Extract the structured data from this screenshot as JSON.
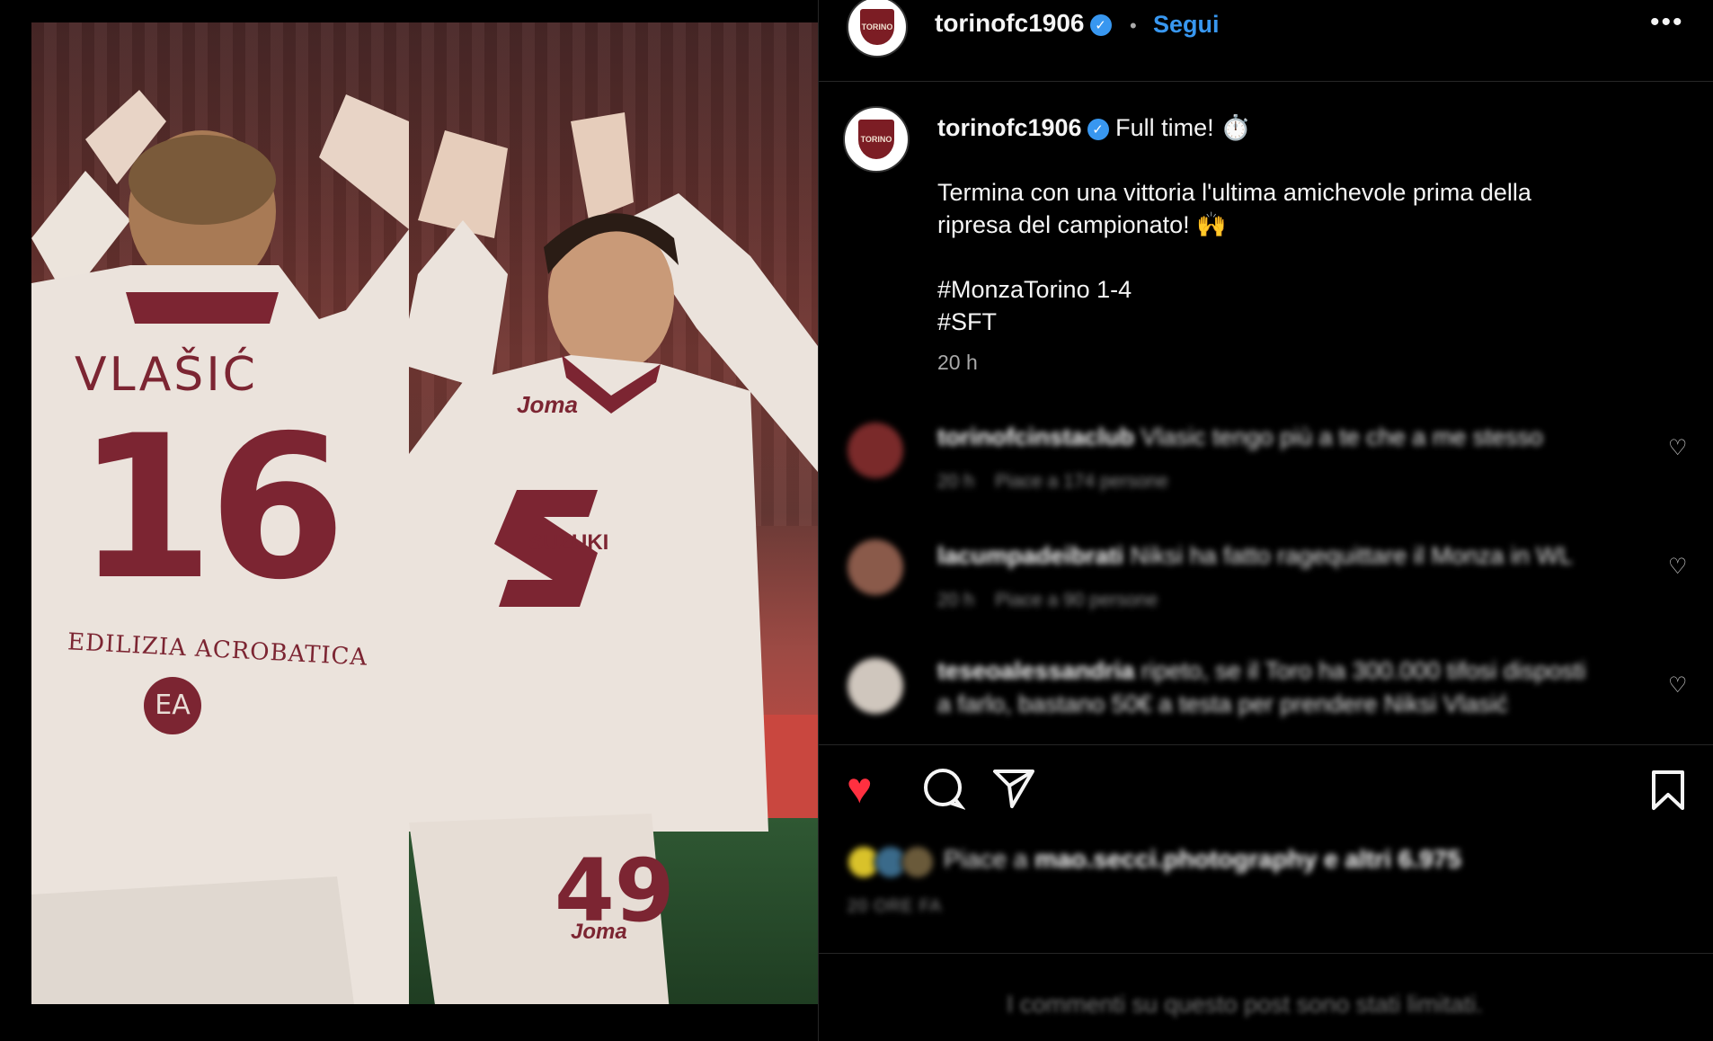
{
  "post_image": {
    "jersey_name": "VLAŠIĆ",
    "jersey_number_1": "16",
    "jersey_sponsor": "EDILIZIA ACROBATICA",
    "jersey_badge": "EA",
    "jersey_brand": "Joma",
    "jersey_sponsor_2": "SUZUKI",
    "jersey_number_2": "49",
    "shorts_brand": "Joma"
  },
  "header": {
    "username": "torinofc1906",
    "separator": "•",
    "follow_label": "Segui",
    "more_label": "•••"
  },
  "caption": {
    "username": "torinofc1906",
    "line1": "Full time! ⏱️",
    "line2": "Termina con una vittoria l'ultima amichevole prima della",
    "line3": "ripresa del campionato! 🙌",
    "hashtag1": "#MonzaTorino 1-4",
    "hashtag2": "#SFT",
    "time": "20 h"
  },
  "comments": [
    {
      "username": "torinofcinstaclub",
      "text": "Vlasic tengo più a te che a me stesso",
      "time": "20 h",
      "likes": "Piace a 174 persone",
      "avatar_color": "#7a2a2a"
    },
    {
      "username": "lacumpadeibrati",
      "text": "Niksi ha fatto ragequittare il Monza in WL",
      "time": "20 h",
      "likes": "Piace a 90 persone",
      "avatar_color": "#8a5a4a"
    },
    {
      "username": "teseoalessandria",
      "text": "ripeto, se il Toro ha 300.000 tifosi disposti",
      "text2": "a farlo, bastano 50€ a testa per prendere Niksi Vlasić",
      "avatar_color": "#cfc6bd"
    }
  ],
  "actions": {
    "like_icon": "♥",
    "comment_icon": "◯",
    "share_icon": "➢",
    "save_icon": "🔖",
    "accent_like": "#ff3040"
  },
  "likes": {
    "prefix": "Piace a",
    "user": "mao.secci.photography",
    "suffix": "e altri 6.975",
    "ago": "20 ORE FA"
  },
  "footer": {
    "limited": "I commenti su questo post sono stati limitati."
  }
}
